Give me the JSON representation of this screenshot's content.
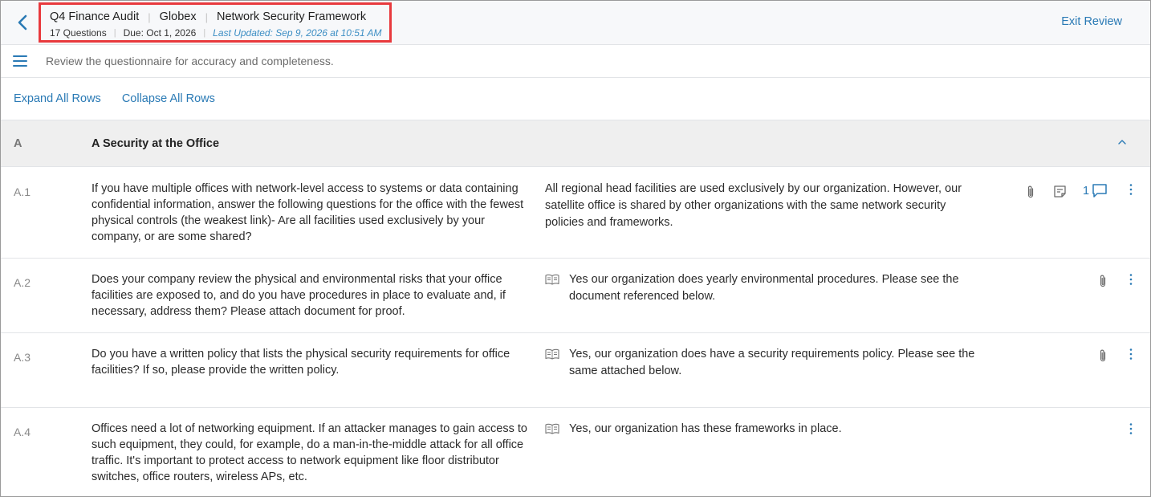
{
  "header": {
    "title": "Q4 Finance Audit",
    "company": "Globex",
    "framework": "Network Security Framework",
    "questions": "17 Questions",
    "due": "Due: Oct 1, 2026",
    "last_updated": "Last Updated: Sep 9, 2026 at 10:51 AM",
    "exit_label": "Exit Review"
  },
  "instruction": "Review the questionnaire for accuracy and completeness.",
  "actions": {
    "expand_all": "Expand All Rows",
    "collapse_all": "Collapse All Rows"
  },
  "section": {
    "id": "A",
    "title": "A Security at the Office"
  },
  "questions": [
    {
      "id": "A.1",
      "text": "If you have multiple offices with network-level access to systems or data containing confidential information, answer the following questions for the office with the fewest physical controls (the weakest link)- Are all facilities used exclusively by your company, or are some shared?",
      "answer": "All regional head facilities are used exclusively by our organization. However, our satellite office is shared by other organizations with the same network security policies and frameworks.",
      "comment_count": "1"
    },
    {
      "id": "A.2",
      "text": "Does your company review the physical and environmental risks that your office facilities are exposed to, and do you have procedures in place to evaluate and, if necessary, address them? Please attach document for proof.",
      "answer": "Yes our organization does yearly environmental procedures. Please see the document referenced below."
    },
    {
      "id": "A.3",
      "text": "Do you have a written policy that lists the physical security requirements for office facilities? If so, please provide the written policy.",
      "answer": "Yes, our organization does have a security requirements policy. Please see the same attached below."
    },
    {
      "id": "A.4",
      "text": "Offices need a lot of networking equipment. If an attacker manages to gain access to such equipment, they could, for example, do a man-in-the-middle attack for all office traffic. It's important to protect access to network equipment like floor distributor switches, office routers, wireless APs, etc.",
      "answer": "Yes, our organization has these frameworks in place."
    }
  ],
  "colors": {
    "accent": "#2a7ab5",
    "highlight_border": "#e8393d",
    "section_bg": "#efefef"
  },
  "icons": [
    "chevron-left-icon",
    "hamburger-menu-icon",
    "chevron-up-icon",
    "paperclip-icon",
    "note-icon",
    "comment-icon",
    "kebab-menu-icon",
    "book-icon"
  ]
}
